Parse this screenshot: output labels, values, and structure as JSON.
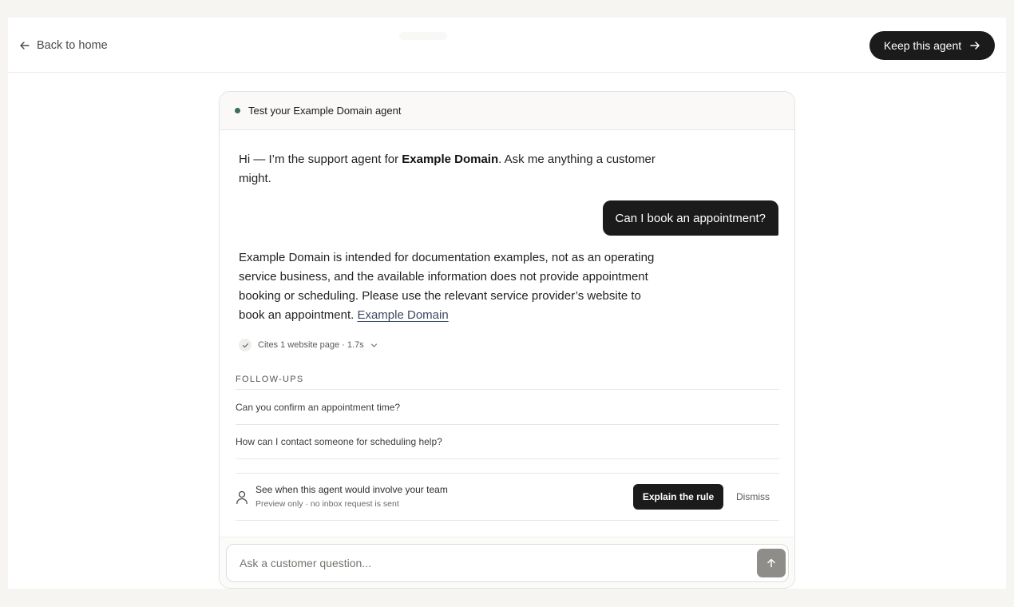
{
  "topbar": {
    "back_label": "Back to home",
    "keep_label": "Keep this agent"
  },
  "chat": {
    "header_title": "Test your Example Domain agent",
    "intro": {
      "before": "Hi — I’m the support agent for ",
      "bold": "Example Domain",
      "after": ". Ask me anything a customer might."
    },
    "user_message": "Can I book an appointment?",
    "answer": {
      "text": "Example Domain is intended for documentation examples, not as an operating service business, and the available information does not provide appointment booking or scheduling. Please use the relevant service provider’s website to book an appointment. ",
      "link_text": "Example Domain"
    },
    "cites_label": "Cites 1 website page · 1.7s",
    "followups_label": "FOLLOW-UPS",
    "followups": [
      "Can you confirm an appointment time?",
      "How can I contact someone for scheduling help?"
    ],
    "escalation": {
      "title": "See when this agent would involve your team",
      "subtitle": "Preview only · no inbox request is sent",
      "explain_label": "Explain the rule",
      "dismiss_label": "Dismiss"
    },
    "composer": {
      "placeholder": "Ask a customer question...",
      "value": ""
    }
  },
  "icons": {
    "back": "arrow-left-icon",
    "keep": "arrow-right-icon",
    "status": "status-dot-icon",
    "cites_check": "check-icon",
    "cites_expand": "chevron-down-icon",
    "person": "person-icon",
    "send": "arrow-up-icon"
  },
  "colors": {
    "primary_dark": "#1b1b1b",
    "status_green": "#3b6e52",
    "send_disabled": "#8e8d89",
    "link": "#3b4a60"
  }
}
